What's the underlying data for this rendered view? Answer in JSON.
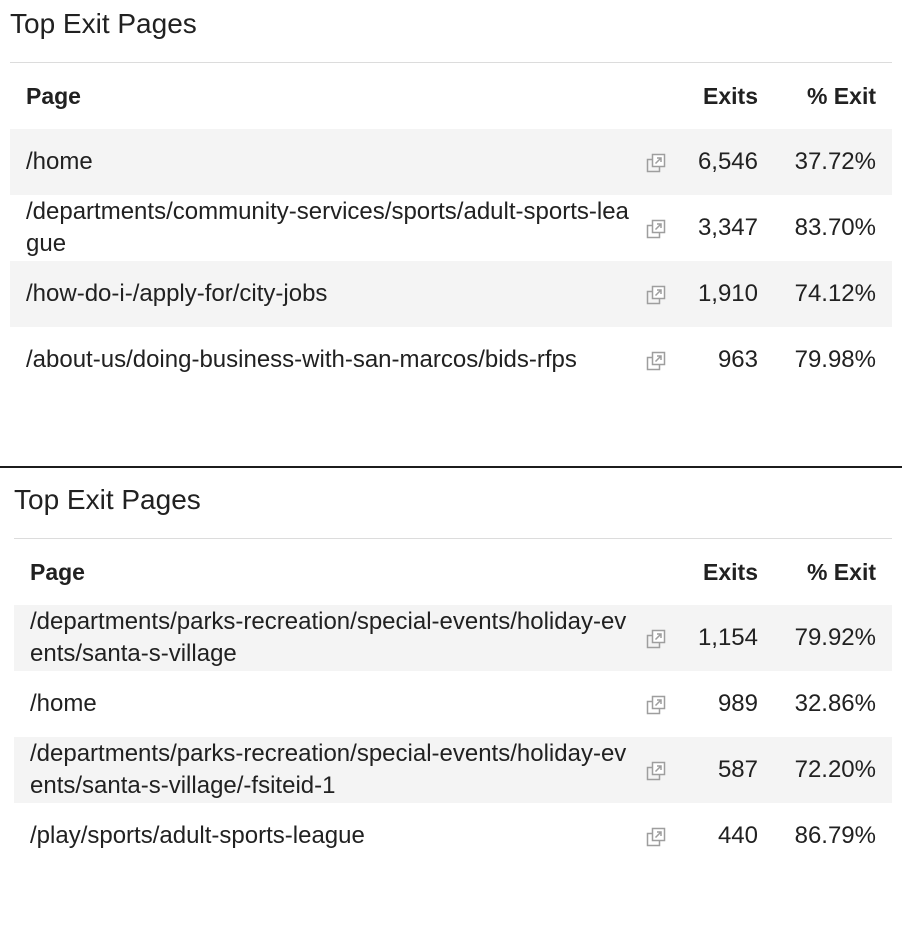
{
  "panels": [
    {
      "title": "Top Exit Pages",
      "headers": {
        "page": "Page",
        "exits": "Exits",
        "pct": "% Exit"
      },
      "rows": [
        {
          "page": "/home",
          "exits": "6,546",
          "pct": "37.72%"
        },
        {
          "page": "/departments/community-services/sports/adult-sports-league",
          "exits": "3,347",
          "pct": "83.70%"
        },
        {
          "page": "/how-do-i-/apply-for/city-jobs",
          "exits": "1,910",
          "pct": "74.12%"
        },
        {
          "page": "/about-us/doing-business-with-san-marcos/bids-rfps",
          "exits": "963",
          "pct": "79.98%"
        }
      ]
    },
    {
      "title": "Top Exit Pages",
      "headers": {
        "page": "Page",
        "exits": "Exits",
        "pct": "% Exit"
      },
      "rows": [
        {
          "page": "/departments/parks-recreation/special-events/holiday-events/santa-s-village",
          "exits": "1,154",
          "pct": "79.92%"
        },
        {
          "page": "/home",
          "exits": "989",
          "pct": "32.86%"
        },
        {
          "page": "/departments/parks-recreation/special-events/holiday-events/santa-s-village/-fsiteid-1",
          "exits": "587",
          "pct": "72.20%"
        },
        {
          "page": "/play/sports/adult-sports-league",
          "exits": "440",
          "pct": "86.79%"
        }
      ]
    }
  ],
  "icons": {
    "row_link": "open-in-new-icon"
  },
  "colors": {
    "row_stripe": "#f4f4f4",
    "divider": "#1c1c1c",
    "text": "#212121",
    "icon": "#9e9e9e"
  }
}
